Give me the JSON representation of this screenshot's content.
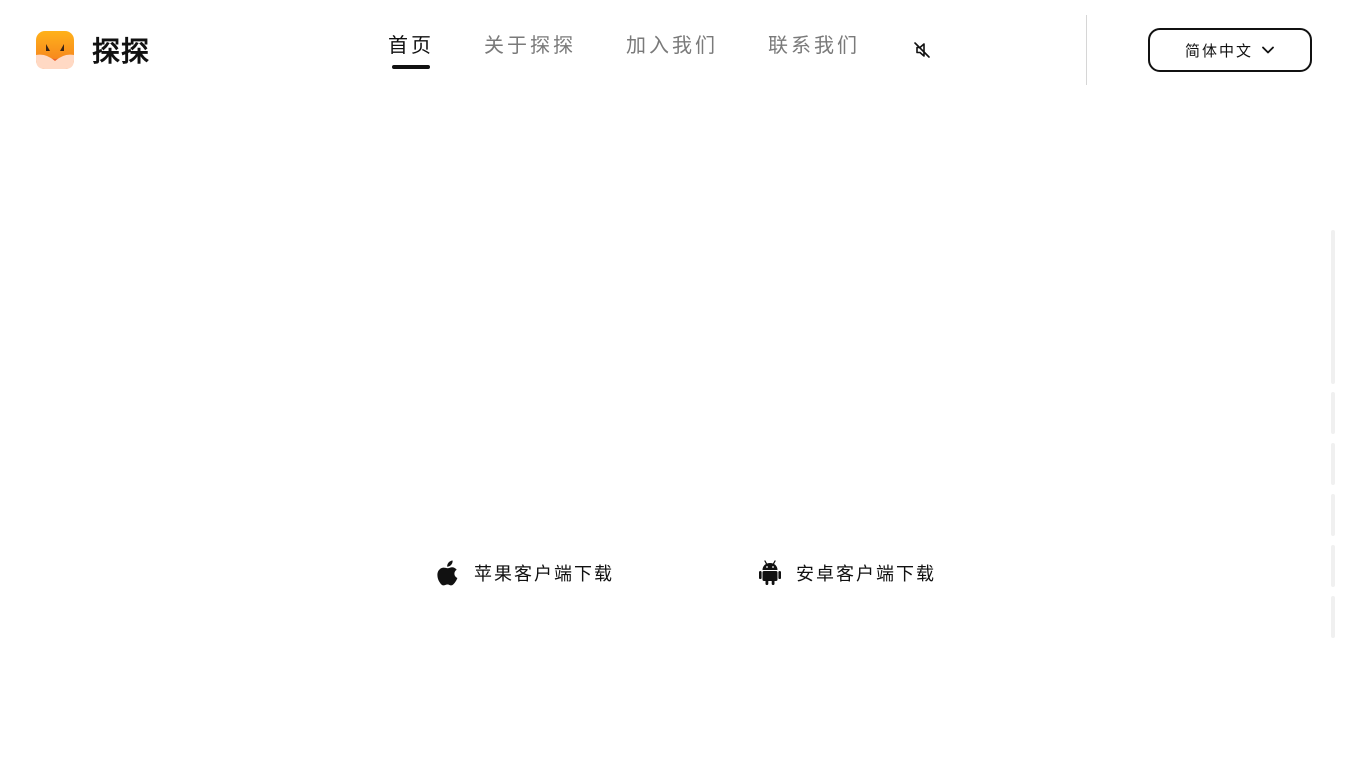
{
  "brand": {
    "name": "探探",
    "logo_icon": "fox-logo-icon",
    "accent_color": "#f5a623"
  },
  "nav": {
    "items": [
      {
        "label": "首页",
        "active": true
      },
      {
        "label": "关于探探",
        "active": false
      },
      {
        "label": "加入我们",
        "active": false
      },
      {
        "label": "联系我们",
        "active": false
      }
    ],
    "mute_icon": "speaker-muted-icon"
  },
  "language": {
    "selected": "简体中文",
    "icon": "chevron-down-icon"
  },
  "downloads": {
    "ios": {
      "label": "苹果客户端下载",
      "icon": "apple-icon"
    },
    "android": {
      "label": "安卓客户端下载",
      "icon": "android-icon"
    }
  }
}
